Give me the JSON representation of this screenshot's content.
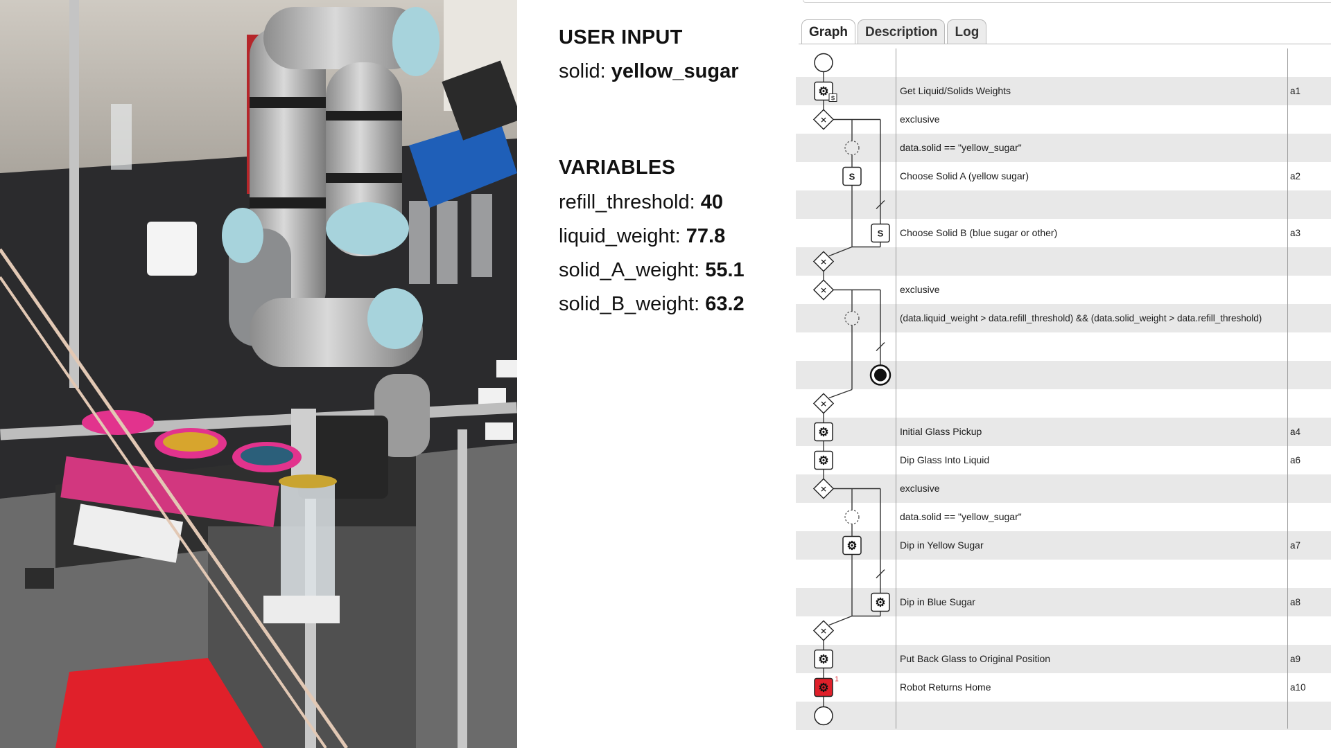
{
  "user_input": {
    "heading": "USER INPUT",
    "key": "solid:",
    "value": "yellow_sugar"
  },
  "variables": {
    "heading": "VARIABLES",
    "items": [
      {
        "key": "refill_threshold:",
        "value": "40"
      },
      {
        "key": "liquid_weight:",
        "value": "77.8"
      },
      {
        "key": "solid_A_weight:",
        "value": "55.1"
      },
      {
        "key": "solid_B_weight:",
        "value": "63.2"
      }
    ]
  },
  "tabs": [
    "Graph",
    "Description",
    "Log"
  ],
  "active_tab": "Graph",
  "process": {
    "rows": [
      {
        "label": "",
        "id": "",
        "node": "start-event"
      },
      {
        "label": "Get Liquid/Solids Weights",
        "id": "a1",
        "node": "service-task-script"
      },
      {
        "label": "exclusive",
        "id": "",
        "node": "exclusive-gateway"
      },
      {
        "label": "data.solid == \"yellow_sugar\"",
        "id": "",
        "node": "condition"
      },
      {
        "label": "Choose Solid A (yellow sugar)",
        "id": "a2",
        "node": "script-task"
      },
      {
        "label": "",
        "id": "",
        "node": "default-flow"
      },
      {
        "label": "Choose Solid B (blue sugar or other)",
        "id": "a3",
        "node": "script-task"
      },
      {
        "label": "",
        "id": "",
        "node": "exclusive-gateway-join"
      },
      {
        "label": "exclusive",
        "id": "",
        "node": "exclusive-gateway"
      },
      {
        "label": "(data.liquid_weight > data.refill_threshold) && (data.solid_weight > data.refill_threshold)",
        "id": "",
        "node": "condition"
      },
      {
        "label": "",
        "id": "",
        "node": "default-flow"
      },
      {
        "label": "",
        "id": "",
        "node": "end-event"
      },
      {
        "label": "",
        "id": "",
        "node": "exclusive-gateway-join"
      },
      {
        "label": "Initial Glass Pickup",
        "id": "a4",
        "node": "service-task"
      },
      {
        "label": "Dip Glass Into Liquid",
        "id": "a6",
        "node": "service-task"
      },
      {
        "label": "exclusive",
        "id": "",
        "node": "exclusive-gateway"
      },
      {
        "label": "data.solid == \"yellow_sugar\"",
        "id": "",
        "node": "condition"
      },
      {
        "label": "Dip in Yellow Sugar",
        "id": "a7",
        "node": "service-task"
      },
      {
        "label": "",
        "id": "",
        "node": "default-flow"
      },
      {
        "label": "Dip in Blue Sugar",
        "id": "a8",
        "node": "service-task"
      },
      {
        "label": "",
        "id": "",
        "node": "exclusive-gateway-join"
      },
      {
        "label": "Put Back Glass to Original Position",
        "id": "a9",
        "node": "service-task"
      },
      {
        "label": "Robot Returns Home",
        "id": "a10",
        "node": "service-task-active"
      },
      {
        "label": "",
        "id": "",
        "node": "end-event"
      }
    ],
    "active_badge": "1",
    "script_marker": "S",
    "colors": {
      "active": "#e0202a",
      "shaded_row": "#e8e8e8",
      "line": "#333333"
    }
  },
  "photo": {
    "semantic": "robot-arm-camera-view"
  }
}
